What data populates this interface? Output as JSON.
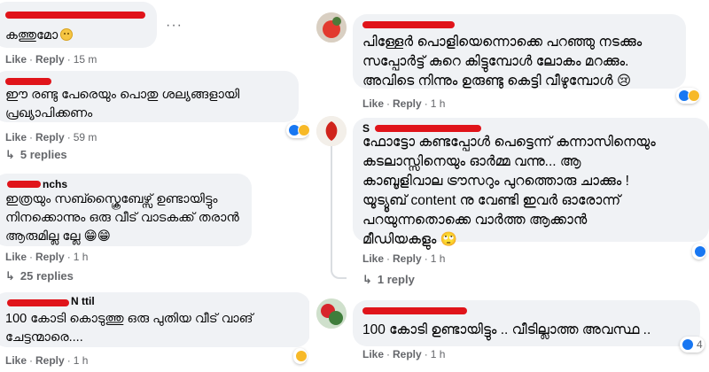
{
  "actions": {
    "like": "Like",
    "reply": "Reply",
    "sep": "·"
  },
  "left": {
    "comments": [
      {
        "text_lines": [
          "കത്തുമോ"
        ],
        "time": "15 m",
        "emoji": "neutral-face",
        "more": "···"
      },
      {
        "text_lines": [
          "ഈ രണ്ടു പേരെയും പൊതു ശല്യങ്ങളായി",
          "പ്രഖ്യാപിക്കണം"
        ],
        "time": "59 m",
        "reaction_count": ""
      },
      {
        "replies_label": "5 replies"
      },
      {
        "name_visible": "nchs",
        "text_lines": [
          "ഇത്രയും സബ്സ്ക്രൈബേഴ്സ് ഉണ്ടായിട്ടും",
          "നിനക്കൊന്നും ഒരു വീട് വാടകക്ക് തരാൻ",
          "ആരുമില്ല ല്ലേ 😁😁"
        ],
        "time": "1 h"
      },
      {
        "replies_label": "25 replies"
      },
      {
        "name_visible": "N ttil",
        "text_lines": [
          "100 കോടി കൊടുത്തു ഒരു പുതിയ വീട് വാങ്",
          "ചേട്ടന്മാരെ...."
        ],
        "time": "1 h"
      }
    ]
  },
  "right": {
    "comments": [
      {
        "text_lines": [
          "പിള്ളേർ പൊളിയെന്നൊക്കെ പറഞ്ഞു നടക്കും",
          "സപ്പോർട്ട് കുറെ കിട്ടുമ്പോൾ ലോകം മറക്കും.",
          "അവിടെ നിന്നും ഉരുണ്ടു കെട്ടി വീഴുമ്പോൾ 😢"
        ],
        "time": "1 h"
      },
      {
        "name_visible": "S",
        "text_lines": [
          "ഫോട്ടോ കണ്ടപ്പോൾ പെട്ടെന്ന് കന്നാസിനെയും",
          "കടലാസ്സിനെയും ഓർമ്മ വന്നു... ആ",
          "കാബൂളിവാല ട്രൗസറും പുറത്തൊരു ചാക്കും !",
          "യൂട്യൂബ് content നു വേണ്ടി ഇവർ ഓരോന്ന്",
          "പറയുന്നതൊക്കെ വാർത്ത ആക്കാൻ",
          "മീഡിയകളും 🙄"
        ],
        "time": "1 h",
        "reaction_count": ""
      },
      {
        "replies_label": "1 reply"
      },
      {
        "text_lines": [
          "100 കോടി ഉണ്ടായിട്ടും .. വീടില്ലാത്ത അവസ്ഥ .."
        ],
        "time": "1 h",
        "reaction_count": "4"
      }
    ]
  }
}
